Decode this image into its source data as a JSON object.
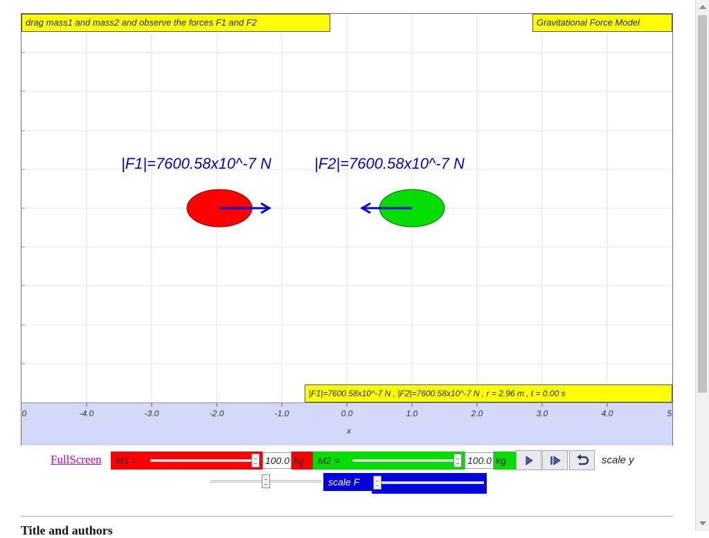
{
  "simulation": {
    "title": "Gravitational Force Model",
    "instruction": "drag mass1 and mass2 and observe the forces F1 and F2",
    "f1_label": "|F1|=7600.58x10^-7 N",
    "f2_label": "|F2|=7600.58x10^-7 N",
    "status": "|F1|=7600.58x10^-7 N , |F2|=7600.58x10^-7 N , r = 2.96 m , t = 0.00 s",
    "mass1_color": "#ff0000",
    "mass2_color": "#00dd00",
    "force_arrow_color": "#0000dd"
  },
  "axis": {
    "x_label": "x",
    "ticks": [
      "0",
      "-4.0",
      "-3.0",
      "-2.0",
      "-1.0",
      "0.0",
      "1.0",
      "2.0",
      "3.0",
      "4.0",
      "5"
    ]
  },
  "controls": {
    "fullscreen_label": "FullScreen",
    "m1_label": "M1 =",
    "m1_value": "100.0",
    "m1_unit": "kg",
    "m1_color": "#ff0000",
    "m2_label": "M2 =",
    "m2_value": "100.0",
    "m2_unit": "kg",
    "m2_color": "#00dd00",
    "scale_y_label": "scale y",
    "scale_f_label": "scale F",
    "scale_f_color": "#0000dd",
    "play_icon": "play-icon",
    "step_icon": "step-forward-icon",
    "reset_icon": "reset-icon"
  },
  "page": {
    "section_heading": "Title and authors"
  }
}
